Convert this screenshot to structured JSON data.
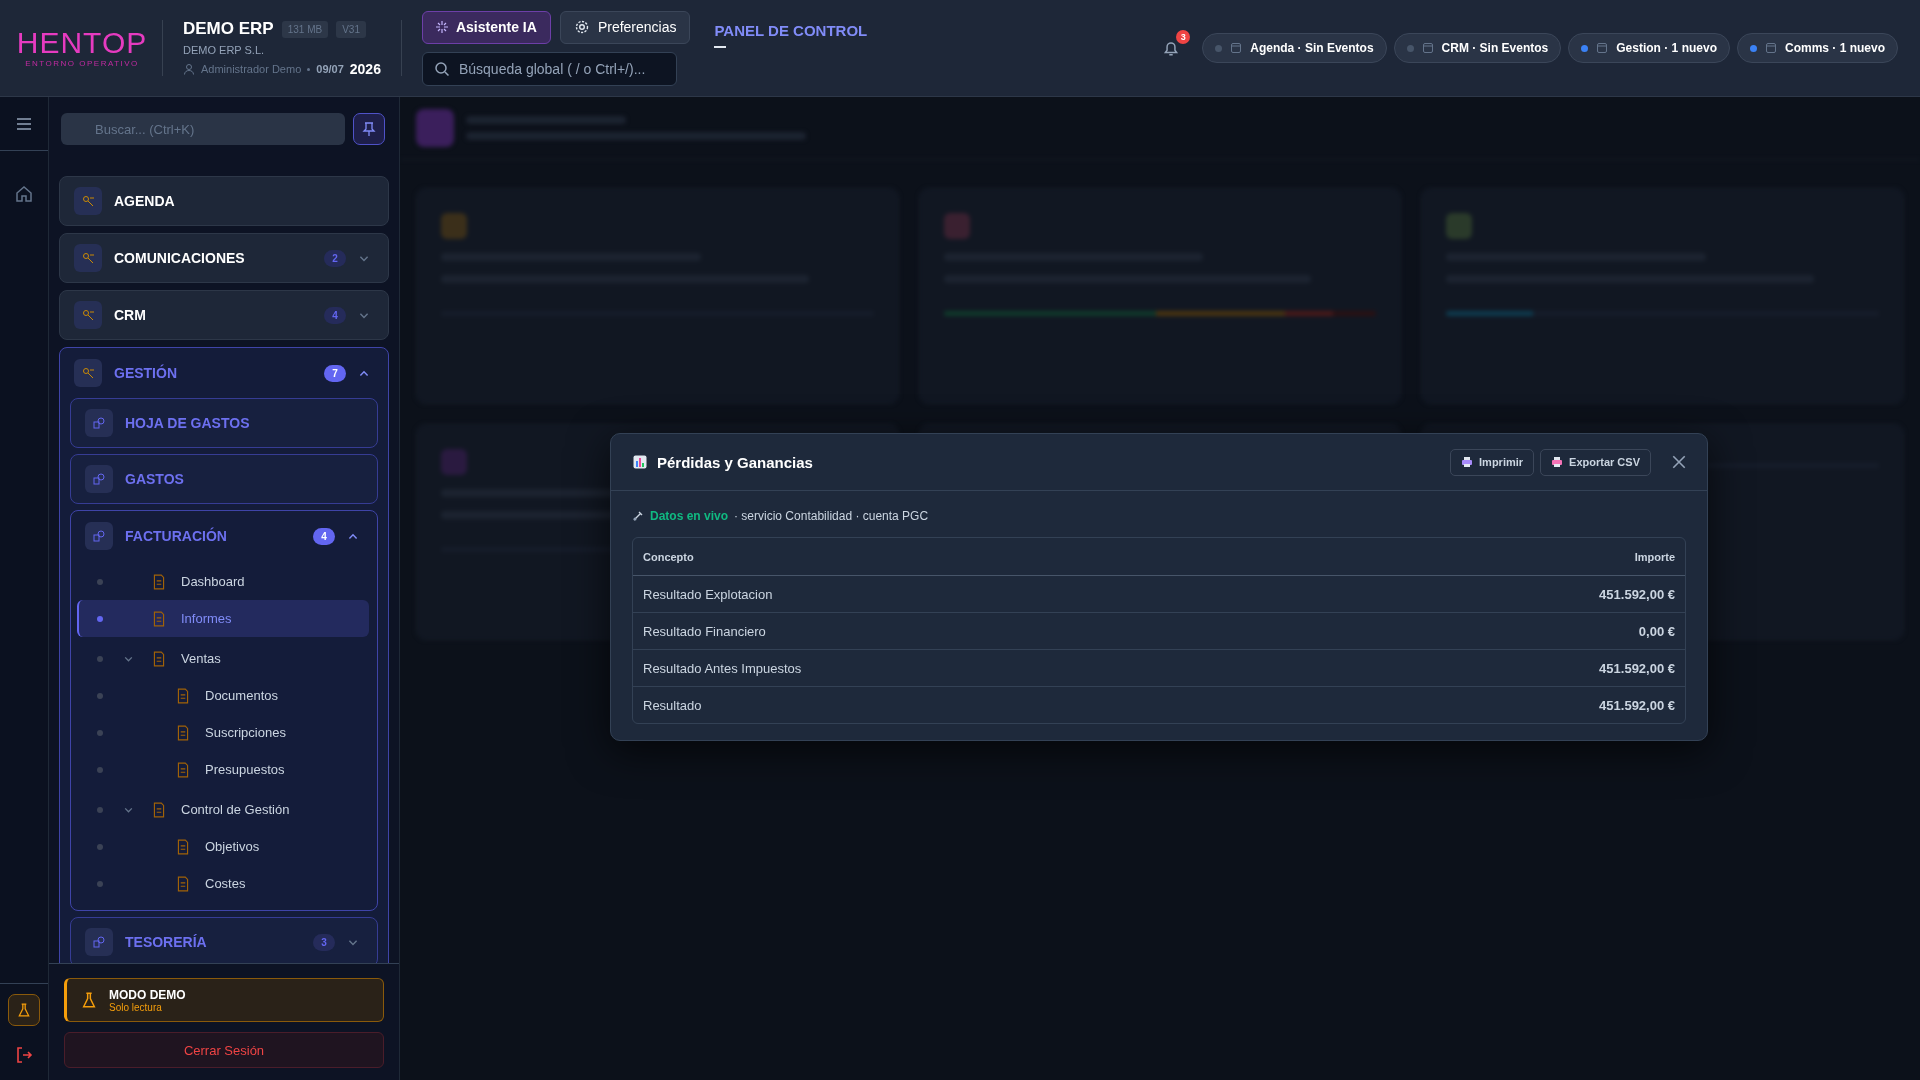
{
  "header": {
    "logo": {
      "name": "HENTOP",
      "tagline": "ENTORNO OPERATIVO"
    },
    "company": {
      "name": "DEMO ERP",
      "badges": [
        "131 MB",
        "V31"
      ],
      "legal_name": "DEMO ERP S.L.",
      "user": "Administrador Demo",
      "date": "09/07",
      "year": "2026"
    },
    "assistant_button": "Asistente IA",
    "preferences_button": "Preferencias",
    "search": {
      "placeholder": "Búsqueda global ( / o Ctrl+/)..."
    },
    "panel_title": "PANEL DE CONTROL",
    "notifications": {
      "count": "3"
    },
    "chips": [
      {
        "label": "Agenda · Sin Eventos",
        "active": false
      },
      {
        "label": "CRM · Sin Eventos",
        "active": false
      },
      {
        "label": "Gestion · 1 nuevo",
        "active": true
      },
      {
        "label": "Comms · 1 nuevo",
        "active": true
      }
    ]
  },
  "sidebar": {
    "search": {
      "placeholder": "Buscar... (Ctrl+K)"
    },
    "sections": [
      {
        "label": "AGENDA"
      },
      {
        "label": "COMUNICACIONES",
        "count": "2",
        "expanded": false
      },
      {
        "label": "CRM",
        "count": "4",
        "expanded": false
      },
      {
        "label": "GESTIÓN",
        "count": "7",
        "expanded": true,
        "children": [
          {
            "label": "HOJA DE GASTOS"
          },
          {
            "label": "GASTOS"
          },
          {
            "label": "FACTURACIÓN",
            "count": "4",
            "expanded": true,
            "children": [
              {
                "label": "Dashboard",
                "selected": false
              },
              {
                "label": "Informes",
                "selected": true
              },
              {
                "label": "Ventas",
                "selected": false,
                "expanded": true,
                "children": [
                  {
                    "label": "Documentos",
                    "selected": false
                  },
                  {
                    "label": "Suscripciones",
                    "selected": false
                  },
                  {
                    "label": "Presupuestos",
                    "selected": false
                  }
                ]
              },
              {
                "label": "Control de Gestión",
                "selected": false,
                "expanded": true,
                "children": [
                  {
                    "label": "Objetivos",
                    "selected": false
                  },
                  {
                    "label": "Costes",
                    "selected": false
                  }
                ]
              }
            ]
          },
          {
            "label": "TESORERÍA",
            "count": "3",
            "expanded": false
          }
        ]
      }
    ],
    "demo": {
      "title": "MODO DEMO",
      "subtitle": "Solo lectura"
    },
    "logout_button": "Cerrar Sesión"
  },
  "modal": {
    "title": "Pérdidas y Ganancias",
    "buttons": [
      "Imprimir",
      "Exportar CSV"
    ],
    "status": {
      "live": "Datos en vivo",
      "source": "· servicio Contabilidad · cuenta PGC"
    },
    "table": {
      "columns": [
        "Concepto",
        "Importe"
      ],
      "rows": [
        [
          "Resultado Explotacion",
          "451.592,00 €"
        ],
        [
          "Resultado Financiero",
          "0,00 €"
        ],
        [
          "Resultado Antes Impuestos",
          "451.592,00 €"
        ],
        [
          "Resultado",
          "451.592,00 €"
        ]
      ]
    }
  }
}
